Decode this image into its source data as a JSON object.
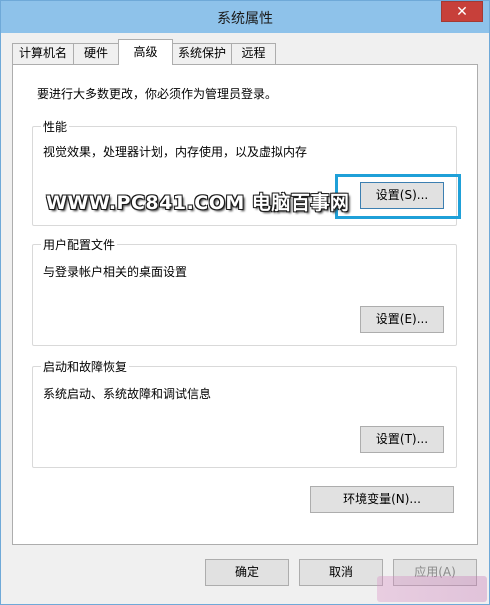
{
  "window": {
    "title": "系统属性",
    "close_glyph": "✕"
  },
  "tabs": [
    {
      "label": "计算机名",
      "active": false
    },
    {
      "label": "硬件",
      "active": false
    },
    {
      "label": "高级",
      "active": true
    },
    {
      "label": "系统保护",
      "active": false
    },
    {
      "label": "远程",
      "active": false
    }
  ],
  "admin_note": "要进行大多数更改，你必须作为管理员登录。",
  "performance": {
    "label": "性能",
    "desc": "视觉效果，处理器计划，内存使用，以及虚拟内存",
    "button": "设置(S)..."
  },
  "user_profiles": {
    "label": "用户配置文件",
    "desc": "与登录帐户相关的桌面设置",
    "button": "设置(E)..."
  },
  "startup": {
    "label": "启动和故障恢复",
    "desc": "系统启动、系统故障和调试信息",
    "button": "设置(T)..."
  },
  "env_button": "环境变量(N)...",
  "footer": {
    "ok": "确定",
    "cancel": "取消",
    "apply": "应用(A)"
  },
  "watermark": "WWW.PC841.COM 电脑百事网",
  "colors": {
    "titlebar": "#8ec2ea",
    "close": "#c7403a",
    "highlight": "#1fa0d8"
  }
}
